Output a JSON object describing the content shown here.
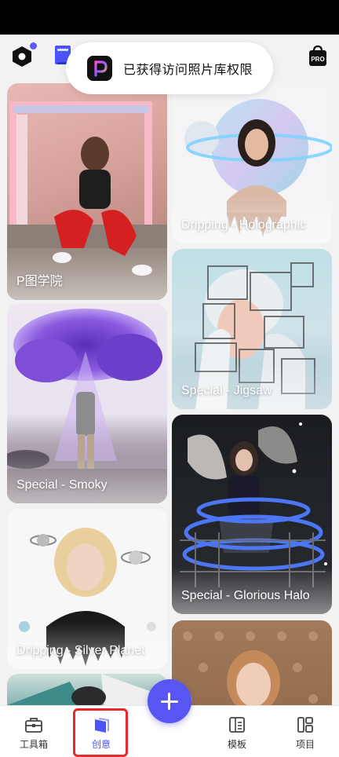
{
  "toast": {
    "text": "已获得访问照片库权限"
  },
  "header": {
    "pro_badge": "PRO"
  },
  "cards": [
    {
      "label": "P图学院"
    },
    {
      "label": "Dripping - Holographic"
    },
    {
      "label": "Special - Jigsaw"
    },
    {
      "label": "Special - Smoky"
    },
    {
      "label": "Special - Glorious Halo"
    },
    {
      "label": "Dripping - Silver Planet"
    },
    {
      "label": ""
    },
    {
      "label": ""
    }
  ],
  "nav": {
    "tabs": [
      {
        "label": "工具箱",
        "icon": "toolbox-icon"
      },
      {
        "label": "创意",
        "icon": "creative-icon"
      },
      {
        "label": "模板",
        "icon": "template-icon"
      },
      {
        "label": "项目",
        "icon": "project-icon"
      }
    ],
    "active_tab": "创意"
  },
  "colors": {
    "accent": "#5856f2",
    "active_tab": "#4a54ff",
    "highlight": "#e8282b"
  }
}
